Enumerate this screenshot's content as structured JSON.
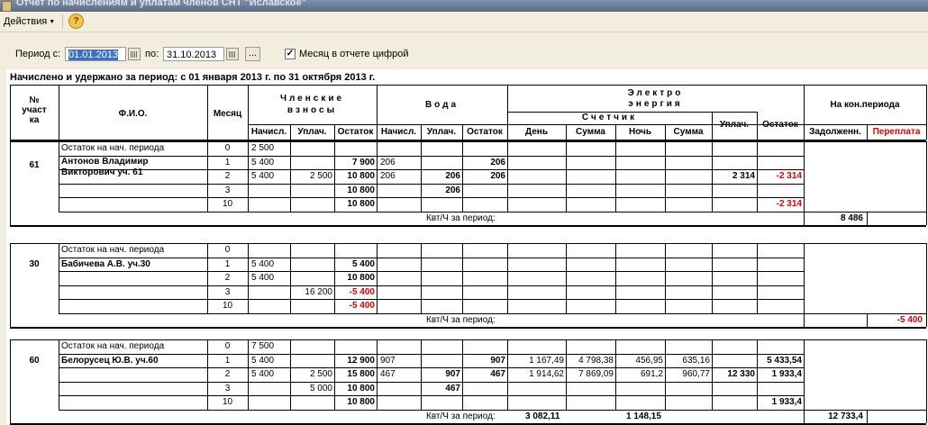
{
  "window": {
    "title": "Отчет по начислениям и уплатам членов СНТ \"Иславское\""
  },
  "toolbar": {
    "actions_label": "Действия",
    "help_label": "?"
  },
  "filters": {
    "period_from_label": "Период с:",
    "period_from_value": "01.01.2013",
    "period_to_label": "по:",
    "period_to_value": "31.10.2013",
    "more_label": "...",
    "month_as_digit_label": "Месяц в отчете цифрой",
    "month_as_digit_checked": true
  },
  "report": {
    "title": "Начислено и удержано за период: с 01 января 2013 г. по 31 октября 2013 г.",
    "headers": {
      "plot_no": [
        "№",
        "участ",
        "ка"
      ],
      "fio": "Ф.И.О.",
      "month": "Месяц",
      "member_fees": [
        "Членские",
        "взносы"
      ],
      "water": "Вода",
      "electro": [
        "Электро",
        "энергия"
      ],
      "meter": "Счетчик",
      "end_period": "На кон.периода",
      "sub": {
        "charged": "Начисл.",
        "paid": "Уплач.",
        "balance": "Остаток",
        "day": "День",
        "sum": "Сумма",
        "night": "Ночь",
        "debt": "Задолженн.",
        "overpay": "Переплата"
      }
    },
    "groups": [
      {
        "plot": "61",
        "name": [
          "Антонов Владимир",
          "Викторович уч. 61"
        ],
        "opening_label": "Остаток на нач. периода",
        "opening_month": "0",
        "opening_fee": "2 500",
        "rows": [
          {
            "month": "1",
            "fee_charged": "5 400",
            "fee_paid": "",
            "fee_balance": "7 900",
            "water_charged": "206",
            "water_paid": "",
            "water_balance": "206",
            "day": "",
            "day_sum": "",
            "night": "",
            "night_sum": "",
            "el_paid": "",
            "el_balance": ""
          },
          {
            "month": "2",
            "fee_charged": "5 400",
            "fee_paid": "2 500",
            "fee_balance": "10 800",
            "water_charged": "206",
            "water_paid": "206",
            "water_balance": "206",
            "day": "",
            "day_sum": "",
            "night": "",
            "night_sum": "",
            "el_paid": "2 314",
            "el_balance": "-2 314"
          },
          {
            "month": "3",
            "fee_charged": "",
            "fee_paid": "",
            "fee_balance": "10 800",
            "water_charged": "",
            "water_paid": "206",
            "water_balance": "",
            "day": "",
            "day_sum": "",
            "night": "",
            "night_sum": "",
            "el_paid": "",
            "el_balance": ""
          },
          {
            "month": "10",
            "fee_charged": "",
            "fee_paid": "",
            "fee_balance": "10 800",
            "water_charged": "",
            "water_paid": "",
            "water_balance": "",
            "day": "",
            "day_sum": "",
            "night": "",
            "night_sum": "",
            "el_paid": "",
            "el_balance": "-2 314"
          }
        ],
        "kwh_label": "Квт/Ч за период:",
        "kwh_day": "",
        "kwh_night": "",
        "debt": "8 486",
        "overpay": ""
      },
      {
        "plot": "30",
        "name": [
          "Бабичева А.В. уч.30"
        ],
        "opening_label": "Остаток на нач. периода",
        "opening_month": "0",
        "opening_fee": "",
        "rows": [
          {
            "month": "1",
            "fee_charged": "5 400",
            "fee_paid": "",
            "fee_balance": "5 400",
            "water_charged": "",
            "water_paid": "",
            "water_balance": "",
            "day": "",
            "day_sum": "",
            "night": "",
            "night_sum": "",
            "el_paid": "",
            "el_balance": ""
          },
          {
            "month": "2",
            "fee_charged": "5 400",
            "fee_paid": "",
            "fee_balance": "10 800",
            "water_charged": "",
            "water_paid": "",
            "water_balance": "",
            "day": "",
            "day_sum": "",
            "night": "",
            "night_sum": "",
            "el_paid": "",
            "el_balance": ""
          },
          {
            "month": "3",
            "fee_charged": "",
            "fee_paid": "16 200",
            "fee_balance": "-5 400",
            "water_charged": "",
            "water_paid": "",
            "water_balance": "",
            "day": "",
            "day_sum": "",
            "night": "",
            "night_sum": "",
            "el_paid": "",
            "el_balance": ""
          },
          {
            "month": "10",
            "fee_charged": "",
            "fee_paid": "",
            "fee_balance": "-5 400",
            "water_charged": "",
            "water_paid": "",
            "water_balance": "",
            "day": "",
            "day_sum": "",
            "night": "",
            "night_sum": "",
            "el_paid": "",
            "el_balance": ""
          }
        ],
        "kwh_label": "Квт/Ч за период:",
        "kwh_day": "",
        "kwh_night": "",
        "debt": "",
        "overpay": "-5 400"
      },
      {
        "plot": "60",
        "name": [
          "Белорусец Ю.В. уч.60"
        ],
        "opening_label": "Остаток на нач. периода",
        "opening_month": "0",
        "opening_fee": "7 500",
        "rows": [
          {
            "month": "1",
            "fee_charged": "5 400",
            "fee_paid": "",
            "fee_balance": "12 900",
            "water_charged": "907",
            "water_paid": "",
            "water_balance": "907",
            "day": "1 167,49",
            "day_sum": "4 798,38",
            "night": "456,95",
            "night_sum": "635,16",
            "el_paid": "",
            "el_balance": "5 433,54"
          },
          {
            "month": "2",
            "fee_charged": "5 400",
            "fee_paid": "2 500",
            "fee_balance": "15 800",
            "water_charged": "467",
            "water_paid": "907",
            "water_balance": "467",
            "day": "1 914,62",
            "day_sum": "7 869,09",
            "night": "691,2",
            "night_sum": "960,77",
            "el_paid": "12 330",
            "el_balance": "1 933,4"
          },
          {
            "month": "3",
            "fee_charged": "",
            "fee_paid": "5 000",
            "fee_balance": "10 800",
            "water_charged": "",
            "water_paid": "467",
            "water_balance": "",
            "day": "",
            "day_sum": "",
            "night": "",
            "night_sum": "",
            "el_paid": "",
            "el_balance": ""
          },
          {
            "month": "10",
            "fee_charged": "",
            "fee_paid": "",
            "fee_balance": "10 800",
            "water_charged": "",
            "water_paid": "",
            "water_balance": "",
            "day": "",
            "day_sum": "",
            "night": "",
            "night_sum": "",
            "el_paid": "",
            "el_balance": "1 933,4"
          }
        ],
        "kwh_label": "Квт/Ч за период:",
        "kwh_day": "3 082,11",
        "kwh_night": "1 148,15",
        "debt": "12 733,4",
        "overpay": ""
      }
    ]
  }
}
